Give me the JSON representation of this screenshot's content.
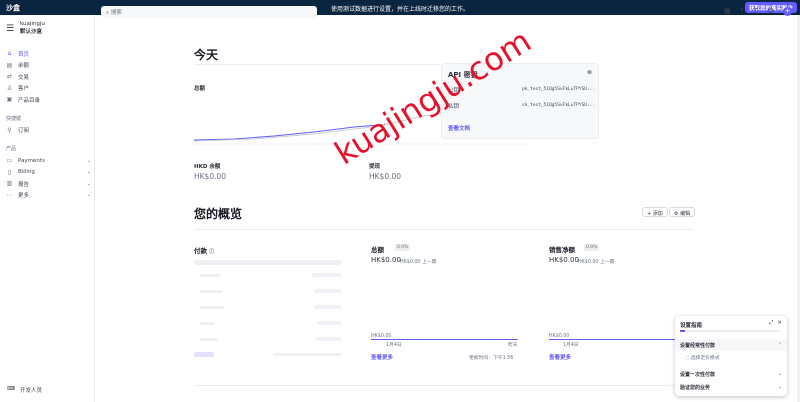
{
  "topbar": {
    "brand": "沙盒",
    "message": "使用测试数据进行设置，并在上线时迁移您的工作。",
    "cta": "获取您的真实账户"
  },
  "account": {
    "name": "kuajingju",
    "env": "默认沙盒"
  },
  "nav": {
    "items": [
      "首页",
      "余额",
      "交易",
      "客户",
      "产品目录"
    ],
    "shortcuts_label": "快捷键",
    "shortcuts": [
      "订阅"
    ],
    "products_label": "产品",
    "products": [
      "Payments",
      "Billing",
      "报告",
      "更多"
    ],
    "developers": "开发人员"
  },
  "search": {
    "placeholder": "搜索"
  },
  "today": {
    "title": "今天",
    "gross_label": "总额",
    "hkd_balance_label": "HKD 余额",
    "hkd_balance": "HK$0.00",
    "payouts_label": "提现",
    "payouts": "HK$0.00"
  },
  "api": {
    "title": "API 密钥",
    "public_label": "公钥",
    "public_key": "pk_test_51Qg5SuFkLuTPYSU...",
    "secret_label": "私钥",
    "secret_key": "sk_test_51Qg5SuFkLuTPYSU...",
    "docs": "查看文档"
  },
  "overview": {
    "title": "您的概览",
    "add": "添加",
    "edit": "编辑"
  },
  "cards": {
    "payments": {
      "title": "付款"
    },
    "gross": {
      "title": "总额",
      "badge": "0.0%",
      "value": "HK$0.00",
      "prev": "HK$0.00 上一期",
      "axis": "HK$0.00",
      "start": "1月4日",
      "end": "昨天",
      "link": "查看更多",
      "updated": "更新时间：下午1:56"
    },
    "net": {
      "title": "销售净额",
      "badge": "0.0%",
      "value": "HK$0.00",
      "prev": "HK$0.00 上一期",
      "axis": "HK$0.00",
      "start": "1月4日",
      "link": "查看更多"
    }
  },
  "watermark": "kuajingju.com",
  "guide": {
    "title": "设置指南",
    "progress": 0.05,
    "section1": "设置经常性付款",
    "sub1": "选择定价模式",
    "section2": "设置一次性付款",
    "section3": "验证您的业务"
  }
}
